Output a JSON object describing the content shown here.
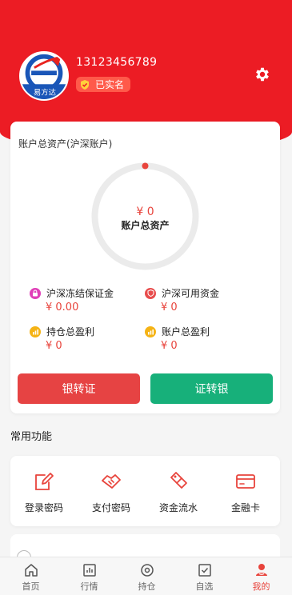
{
  "profile": {
    "phone": "13123456789",
    "verified_label": "已实名",
    "avatar_text": "易方达"
  },
  "assets": {
    "title": "账户总资产(沪深账户)",
    "ring_value": "¥ 0",
    "ring_label": "账户总资产",
    "stats": [
      {
        "label": "沪深冻结保证金",
        "value": "¥ 0.00",
        "icon": "lock-icon",
        "color": "#e040b8"
      },
      {
        "label": "沪深可用资金",
        "value": "¥ 0",
        "icon": "shield-icon",
        "color": "#e84d4d"
      },
      {
        "label": "持仓总盈利",
        "value": "¥ 0",
        "icon": "chart-icon",
        "color": "#f5b315"
      },
      {
        "label": "账户总盈利",
        "value": "¥ 0",
        "icon": "chart-icon",
        "color": "#f5b315"
      }
    ],
    "bank_to_sec_label": "银转证",
    "sec_to_bank_label": "证转银"
  },
  "functions": {
    "section_title": "常用功能",
    "items": [
      {
        "label": "登录密码",
        "icon": "edit-icon"
      },
      {
        "label": "支付密码",
        "icon": "handshake-icon"
      },
      {
        "label": "资金流水",
        "icon": "tag-icon"
      },
      {
        "label": "金融卡",
        "icon": "card-icon"
      }
    ]
  },
  "tabs": [
    {
      "label": "首页",
      "icon": "home-icon"
    },
    {
      "label": "行情",
      "icon": "market-icon"
    },
    {
      "label": "持仓",
      "icon": "position-icon"
    },
    {
      "label": "自选",
      "icon": "watchlist-icon"
    },
    {
      "label": "我的",
      "icon": "user-icon",
      "active": true
    }
  ],
  "colors": {
    "brand": "#ec1c24",
    "accent_red": "#e8443c",
    "button_red": "#e64343",
    "button_green": "#17b07a"
  }
}
